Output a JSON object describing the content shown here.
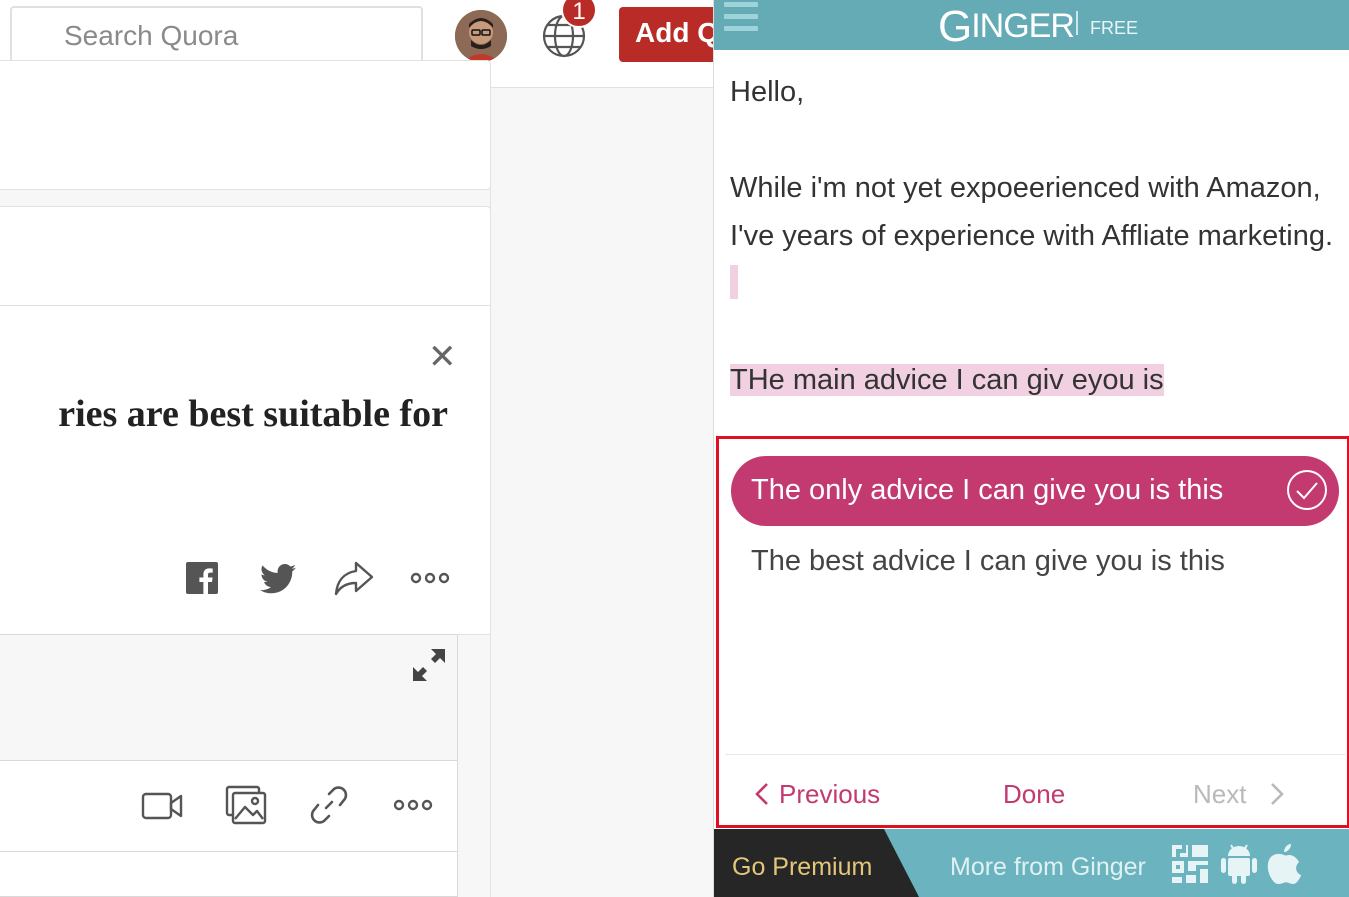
{
  "quora": {
    "search_placeholder": "Search Quora",
    "notification_count": "1",
    "add_question_label": "Add Q",
    "question_title_fragment": "ries are best suitable for"
  },
  "ginger": {
    "logo_text": "INGER",
    "logo_initial": "G",
    "tier": "FREE",
    "text": {
      "greeting": "Hello,",
      "paragraph1": "While i'm not yet expoeerienced with Amazon, I've years of experience with Affliate marketing.",
      "highlighted_sentence": "THe main advice I can giv eyou is"
    },
    "suggestions": [
      {
        "text": "The only advice I can give you is this",
        "selected": true
      },
      {
        "text": "The best advice I can give you is this",
        "selected": false
      }
    ],
    "nav": {
      "previous": "Previous",
      "done": "Done",
      "next": "Next"
    },
    "footer": {
      "go_premium": "Go Premium",
      "more": "More from Ginger"
    }
  },
  "colors": {
    "quora_red": "#b92b27",
    "ginger_teal": "#64abb6",
    "ginger_magenta": "#c23a70",
    "highlight_pink": "#f1d0e1",
    "annotation_red": "#e01020",
    "premium_gold": "#e4c67a"
  },
  "icons": [
    "search-icon",
    "avatar",
    "globe-icon",
    "close-icon",
    "facebook-icon",
    "twitter-icon",
    "share-icon",
    "more-icon",
    "expand-icon",
    "video-icon",
    "image-icon",
    "link-icon",
    "menu-icon",
    "check-icon",
    "chevron-left-icon",
    "chevron-right-icon",
    "app-store-icon",
    "android-icon",
    "apple-icon"
  ]
}
